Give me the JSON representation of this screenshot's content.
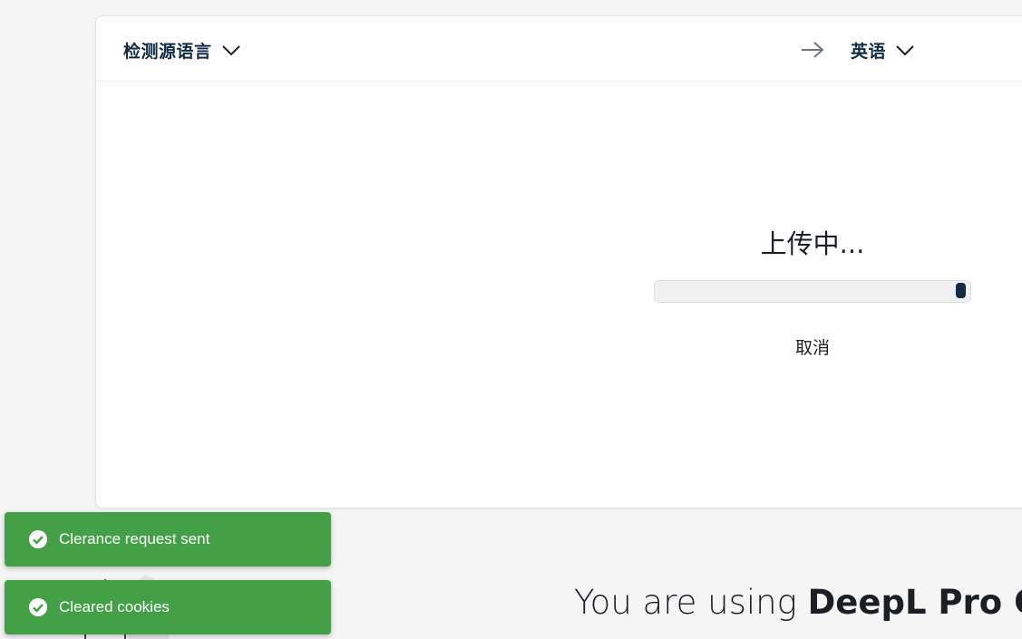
{
  "translator": {
    "source_lang": "检测源语言",
    "target_lang": "英语",
    "upload": {
      "status": "上传中...",
      "progress": 0.97,
      "cancel_label": "取消"
    }
  },
  "promo": {
    "prefix": "You are using ",
    "product": "DeepL Pro Cra"
  },
  "toasts": [
    {
      "message": "Clerance request sent",
      "icon": "check-circle-icon"
    },
    {
      "message": "Cleared cookies",
      "icon": "check-circle-icon"
    }
  ],
  "colors": {
    "brand_navy": "#0f2b46",
    "toast_green": "#44a047",
    "background": "#f5f5f5"
  }
}
